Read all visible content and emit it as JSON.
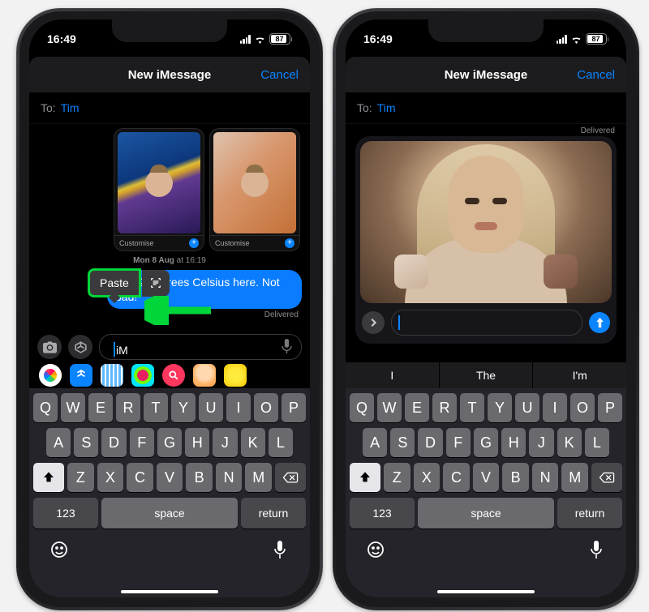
{
  "status": {
    "time": "16:49",
    "battery": "87"
  },
  "nav": {
    "title": "New iMessage",
    "cancel": "Cancel"
  },
  "to": {
    "label": "To:",
    "recipient": "Tim"
  },
  "left": {
    "thumb_label": "Customise",
    "timestamp_day": "Mon 8 Aug",
    "timestamp_time": " at 16:19",
    "bubble": "It's 22 degrees Celsius here. Not bad!",
    "delivered": "Delivered",
    "paste": "Paste"
  },
  "right": {
    "delivered": "Delivered",
    "suggestions": [
      "I",
      "The",
      "I'm"
    ]
  },
  "keyboard": {
    "row1": [
      "Q",
      "W",
      "E",
      "R",
      "T",
      "Y",
      "U",
      "I",
      "O",
      "P"
    ],
    "row2": [
      "A",
      "S",
      "D",
      "F",
      "G",
      "H",
      "J",
      "K",
      "L"
    ],
    "row3": [
      "Z",
      "X",
      "C",
      "V",
      "B",
      "N",
      "M"
    ],
    "num": "123",
    "space": "space",
    "ret": "return"
  }
}
